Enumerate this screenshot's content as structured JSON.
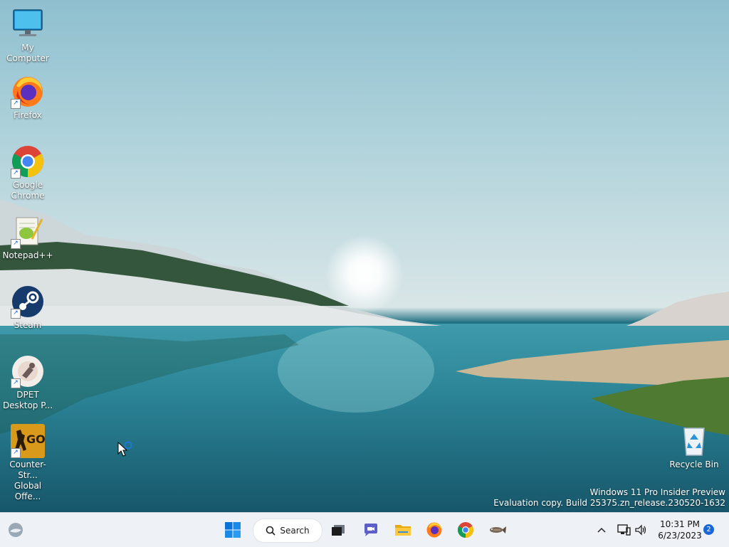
{
  "desktop": {
    "icons": [
      {
        "name": "my-computer",
        "line1": "My Computer",
        "line2": ""
      },
      {
        "name": "firefox",
        "line1": "Firefox",
        "line2": ""
      },
      {
        "name": "google-chrome",
        "line1": "Google",
        "line2": "Chrome"
      },
      {
        "name": "notepad-plus-plus",
        "line1": "Notepad++",
        "line2": ""
      },
      {
        "name": "steam",
        "line1": "Steam",
        "line2": ""
      },
      {
        "name": "dpet",
        "line1": "DPET",
        "line2": "Desktop P..."
      },
      {
        "name": "counter-strike",
        "line1": "Counter-Str...",
        "line2": "Global Offe..."
      },
      {
        "name": "recycle-bin",
        "line1": "Recycle Bin",
        "line2": ""
      }
    ],
    "csgo_badge": "GO",
    "shortcut_glyph": "↗",
    "watermark": {
      "line1": "Windows 11 Pro Insider Preview",
      "line2": "Evaluation copy. Build 25375.zn_release.230520-1632"
    }
  },
  "taskbar": {
    "search_label": "Search",
    "clock_time": "10:31 PM",
    "clock_date": "6/23/2023",
    "notification_count": "2",
    "accent": "#0a73d8",
    "icons": [
      "widgets-icon",
      "start-icon",
      "search-icon",
      "task-view-icon",
      "chat-icon",
      "file-explorer-icon",
      "firefox-icon",
      "chrome-icon",
      "fish-icon",
      "chevron-up-icon",
      "network-icon",
      "volume-icon"
    ]
  }
}
